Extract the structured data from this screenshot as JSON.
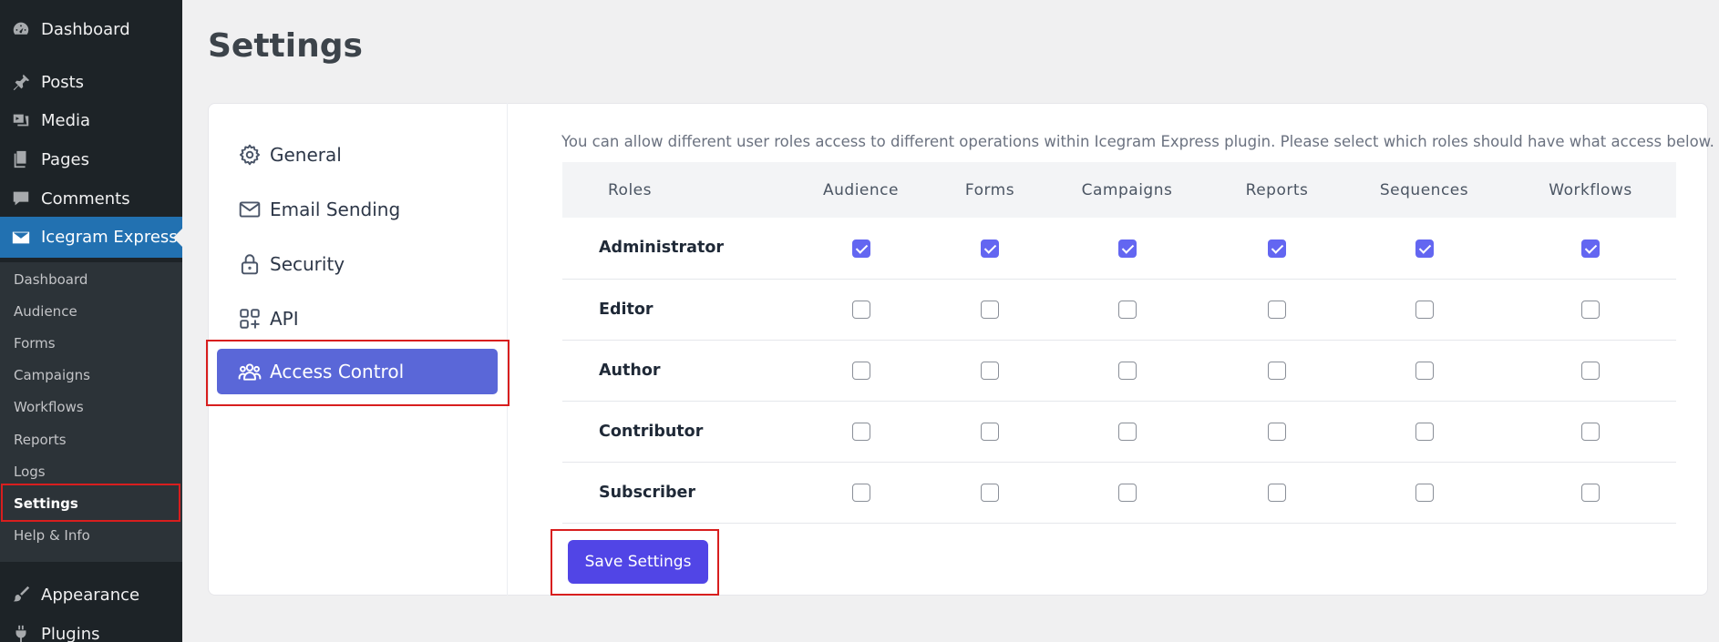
{
  "sidebar": {
    "items": [
      {
        "label": "Dashboard",
        "icon": "dashboard-icon"
      },
      {
        "label": "Posts",
        "icon": "pin-icon"
      },
      {
        "label": "Media",
        "icon": "media-icon"
      },
      {
        "label": "Pages",
        "icon": "pages-icon"
      },
      {
        "label": "Comments",
        "icon": "comment-icon"
      },
      {
        "label": "Icegram Express",
        "icon": "envelope-icon",
        "current": true
      },
      {
        "label": "Appearance",
        "icon": "brush-icon"
      },
      {
        "label": "Plugins",
        "icon": "plug-icon"
      }
    ],
    "submenu": [
      "Dashboard",
      "Audience",
      "Forms",
      "Campaigns",
      "Workflows",
      "Reports",
      "Logs",
      "Settings",
      "Help & Info"
    ],
    "active_submenu": "Settings"
  },
  "page": {
    "title": "Settings"
  },
  "settings_nav": {
    "items": [
      {
        "label": "General",
        "icon": "gear-icon"
      },
      {
        "label": "Email Sending",
        "icon": "envelope-icon"
      },
      {
        "label": "Security",
        "icon": "lock-icon"
      },
      {
        "label": "API",
        "icon": "apps-icon"
      },
      {
        "label": "Access Control",
        "icon": "users-icon",
        "active": true
      }
    ]
  },
  "access_control": {
    "intro": "You can allow different user roles access to different operations within Icegram Express plugin. Please select which roles should have what access below.",
    "columns": [
      "Roles",
      "Audience",
      "Forms",
      "Campaigns",
      "Reports",
      "Sequences",
      "Workflows"
    ],
    "rows": [
      {
        "role": "Administrator",
        "checked": [
          true,
          true,
          true,
          true,
          true,
          true
        ]
      },
      {
        "role": "Editor",
        "checked": [
          false,
          false,
          false,
          false,
          false,
          false
        ]
      },
      {
        "role": "Author",
        "checked": [
          false,
          false,
          false,
          false,
          false,
          false
        ]
      },
      {
        "role": "Contributor",
        "checked": [
          false,
          false,
          false,
          false,
          false,
          false
        ]
      },
      {
        "role": "Subscriber",
        "checked": [
          false,
          false,
          false,
          false,
          false,
          false
        ]
      }
    ],
    "save_label": "Save Settings"
  },
  "colors": {
    "sidebar_bg": "#1d2327",
    "sidebar_current": "#2271b1",
    "accent": "#5a67d8",
    "button": "#5145e6",
    "highlight_box": "#d81e1e"
  }
}
